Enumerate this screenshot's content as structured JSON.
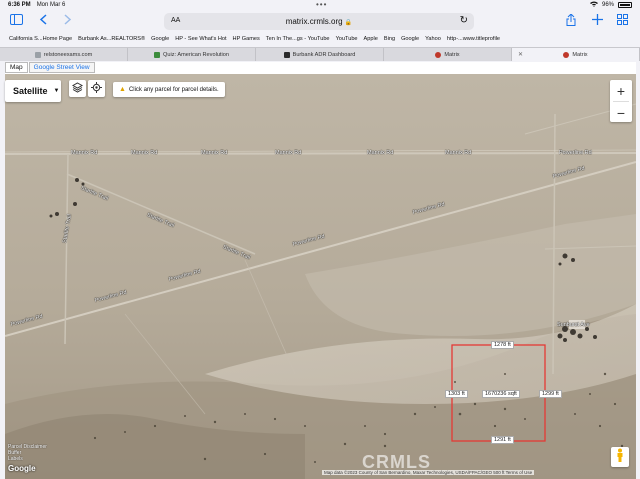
{
  "status": {
    "time": "6:36 PM",
    "date": "Mon Mar 6",
    "battery": "96%"
  },
  "browser": {
    "aa_label": "AA",
    "url": "matrix.crmls.org",
    "bookmarks": [
      "California S...Home Page",
      "Burbank As...REALTORS®",
      "Google",
      "HP - See What's Hot",
      "HP Games",
      "Ten In The...gs - YouTube",
      "YouTube",
      "Apple",
      "Bing",
      "Google",
      "Yahoo",
      "http-...www.titleprofile"
    ],
    "tabs": [
      {
        "label": "relstoneexams.com",
        "active": false,
        "color": "#9aa0a6"
      },
      {
        "label": "Quiz: American Revolution",
        "active": false,
        "color": "#3c8c3c"
      },
      {
        "label": "Burbank ADR Dashboard",
        "active": false,
        "color": "#2b2b2b"
      },
      {
        "label": "Matrix",
        "active": false,
        "color": "#c0392b"
      },
      {
        "label": "Matrix",
        "active": true,
        "color": "#c0392b"
      }
    ]
  },
  "map": {
    "tabs": [
      "Map",
      "Google Street View"
    ],
    "maptype": "Satellite",
    "hint": "Click any parcel for parcel details.",
    "zoom_in": "+",
    "zoom_out": "−",
    "roads": [
      {
        "name": "Mannix Rd"
      },
      {
        "name": "Mannix Rd"
      },
      {
        "name": "Mannix Rd"
      },
      {
        "name": "Mannix Rd"
      },
      {
        "name": "Mannix Rd"
      },
      {
        "name": "Mannix Rd"
      },
      {
        "name": "Starlite Trail"
      },
      {
        "name": "Starlite Trail"
      },
      {
        "name": "Starlite Trail"
      },
      {
        "name": "Powerline Rd"
      },
      {
        "name": "Powerline Rd"
      },
      {
        "name": "Powerline Rd"
      },
      {
        "name": "Powerline Rd"
      },
      {
        "name": "Powerline Rd"
      },
      {
        "name": "Powerline Rd"
      },
      {
        "name": "Starlite Trail"
      },
      {
        "name": "Sunburst Ave"
      }
    ],
    "parcel": {
      "top": "1278 ft",
      "left": "1303 ft",
      "right": "1299 ft",
      "bottom": "1291 ft",
      "area": "1670236 sqft"
    },
    "bottom_left_note": "Parcel Disclaimer\nBuffer\nLabels",
    "attribution": "Map data ©2023 County of San Bernardino, Maxar Technologies, USDA/FPAC/GEO  500 ft  Terms of Use",
    "watermark": "CRMLS",
    "google_logo": "Google"
  },
  "colors": {
    "accent": "#1a73e8",
    "parcel_outline": "#e53935",
    "desert": "#bdb3a3"
  }
}
